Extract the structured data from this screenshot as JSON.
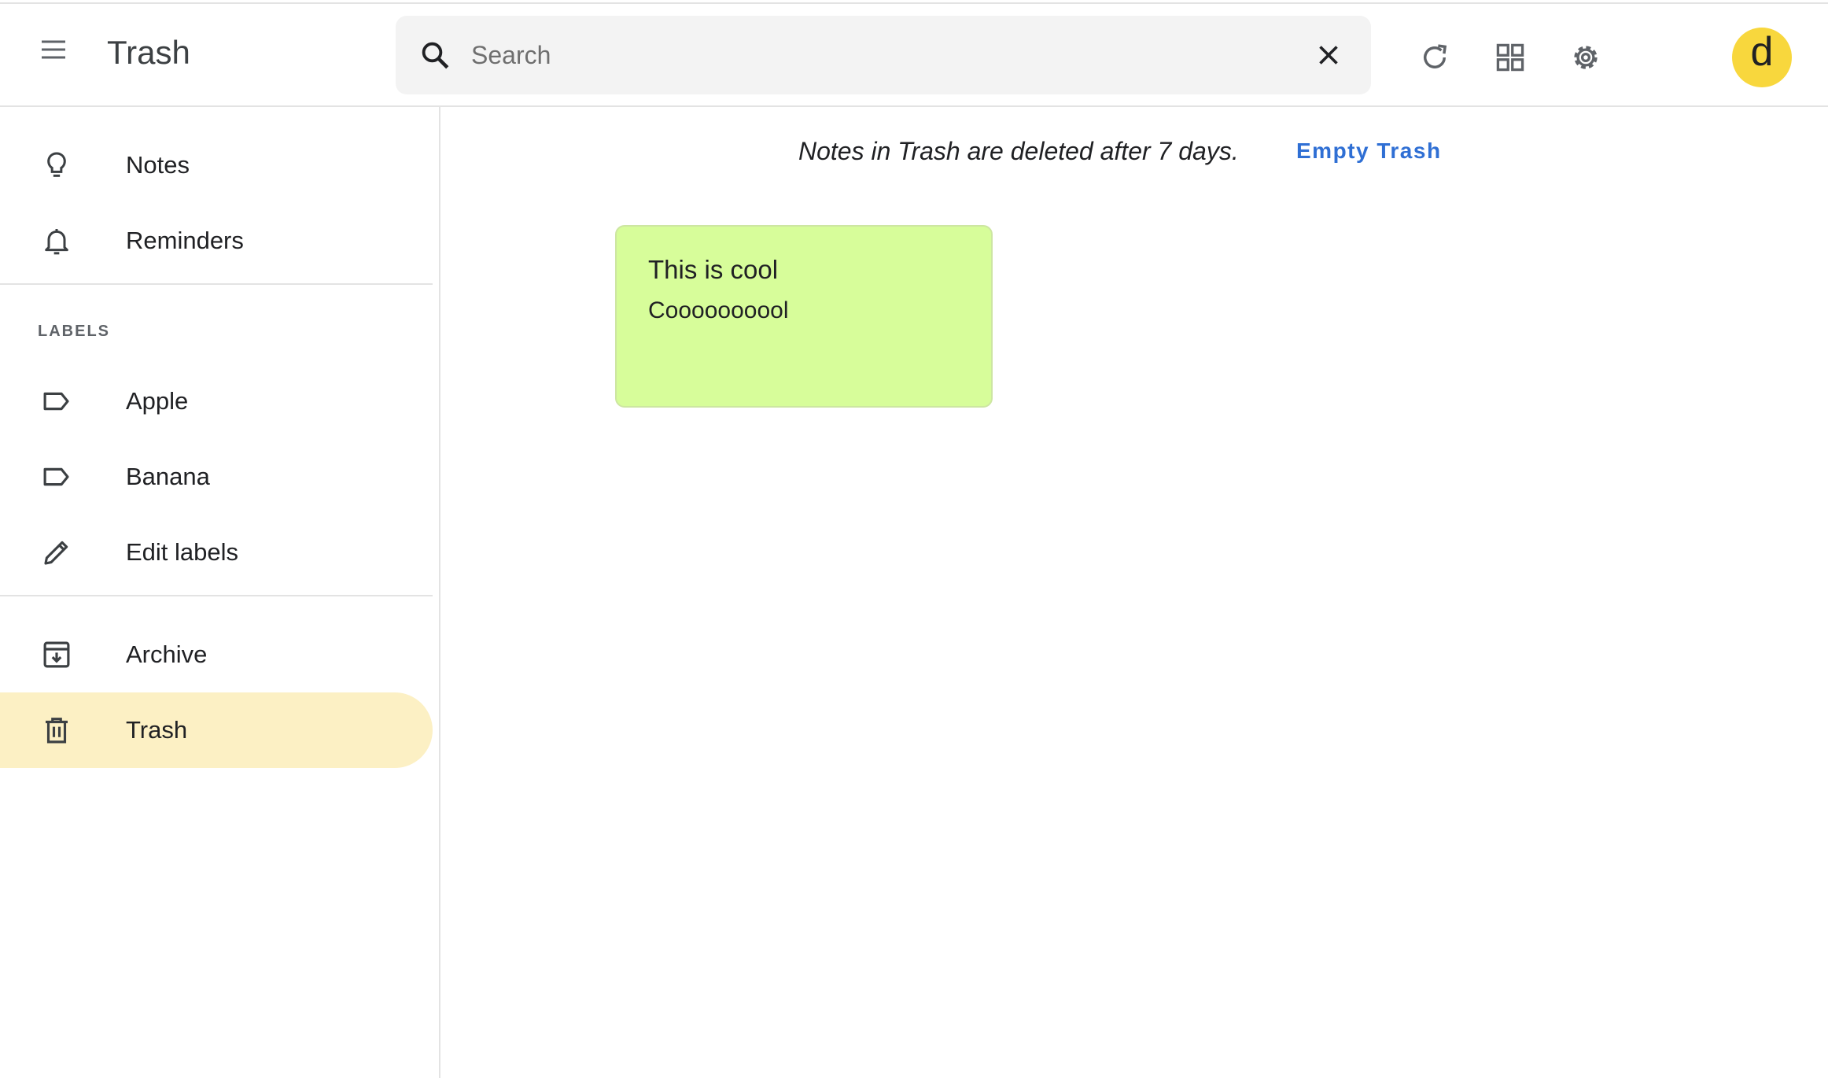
{
  "header": {
    "title": "Trash",
    "search": {
      "placeholder": "Search",
      "value": ""
    },
    "avatar_letter": "d",
    "avatar_color": "#f8d73d"
  },
  "icons": {
    "menu": "menu-icon",
    "search": "search-icon",
    "clear": "close-icon",
    "refresh": "refresh-icon",
    "layout": "grid-view-icon",
    "settings": "gear-icon"
  },
  "sidebar": {
    "items": [
      {
        "label": "Notes",
        "icon": "lightbulb-icon"
      },
      {
        "label": "Reminders",
        "icon": "bell-icon"
      }
    ],
    "labels_heading": "LABELS",
    "labels": [
      {
        "label": "Apple",
        "icon": "label-icon"
      },
      {
        "label": "Banana",
        "icon": "label-icon"
      },
      {
        "label": "Edit labels",
        "icon": "pencil-icon"
      }
    ],
    "bottom_items": [
      {
        "label": "Archive",
        "icon": "archive-icon"
      },
      {
        "label": "Trash",
        "icon": "trash-icon",
        "active": true
      }
    ],
    "active_color": "#fcf0c4"
  },
  "main": {
    "notice": "Notes in Trash are deleted after 7 days.",
    "empty_trash_label": "Empty Trash",
    "notes": [
      {
        "title": "This is cool",
        "body": "Coooooooool",
        "color": "#d7fd9a"
      }
    ]
  }
}
